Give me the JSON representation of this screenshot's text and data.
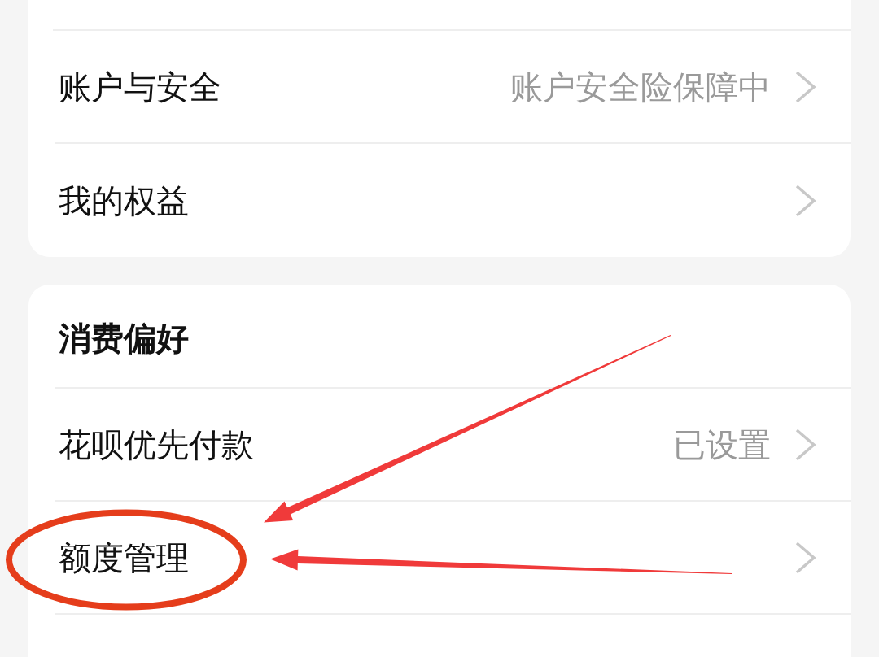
{
  "groups": [
    {
      "cut_top": true,
      "cut_bottom": false,
      "items": [
        {
          "kind": "link",
          "label": "账户与安全",
          "value": "账户安全险保障中",
          "highlighted": false
        },
        {
          "kind": "link",
          "label": "我的权益",
          "highlighted": false
        }
      ]
    },
    {
      "cut_top": false,
      "cut_bottom": true,
      "items": [
        {
          "kind": "header",
          "label": "消费偏好"
        },
        {
          "kind": "link",
          "label": "花呗优先付款",
          "value": "已设置",
          "highlighted": false
        },
        {
          "kind": "link",
          "label": "额度管理",
          "highlighted": true
        }
      ]
    }
  ]
}
